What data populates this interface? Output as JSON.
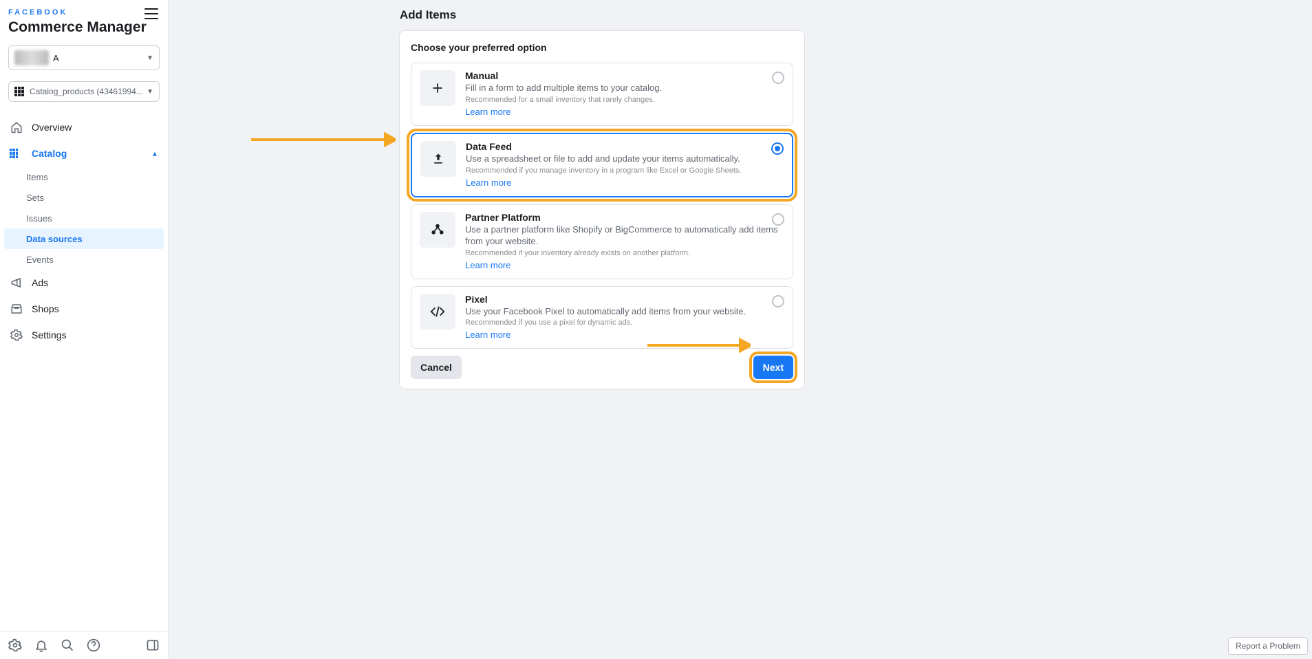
{
  "brand": "FACEBOOK",
  "app_title": "Commerce Manager",
  "account_selector": {
    "label": "A"
  },
  "catalog_selector": {
    "label": "Catalog_products (43461994..."
  },
  "nav": {
    "overview": "Overview",
    "catalog": "Catalog",
    "catalog_sub": {
      "items": "Items",
      "sets": "Sets",
      "issues": "Issues",
      "data_sources": "Data sources",
      "events": "Events"
    },
    "ads": "Ads",
    "shops": "Shops",
    "settings": "Settings"
  },
  "page": {
    "title": "Add Items",
    "heading": "Choose your preferred option",
    "learn_more": "Learn more",
    "options": {
      "manual": {
        "title": "Manual",
        "desc": "Fill in a form to add multiple items to your catalog.",
        "rec": "Recommended for a small inventory that rarely changes."
      },
      "feed": {
        "title": "Data Feed",
        "desc": "Use a spreadsheet or file to add and update your items automatically.",
        "rec": "Recommended if you manage inventory in a program like Excel or Google Sheets."
      },
      "partner": {
        "title": "Partner Platform",
        "desc": "Use a partner platform like Shopify or BigCommerce to automatically add items from your website.",
        "rec": "Recommended if your inventory already exists on another platform."
      },
      "pixel": {
        "title": "Pixel",
        "desc": "Use your Facebook Pixel to automatically add items from your website.",
        "rec": "Recommended if you use a pixel for dynamic ads."
      }
    },
    "cancel": "Cancel",
    "next": "Next"
  },
  "report": "Report a Problem"
}
